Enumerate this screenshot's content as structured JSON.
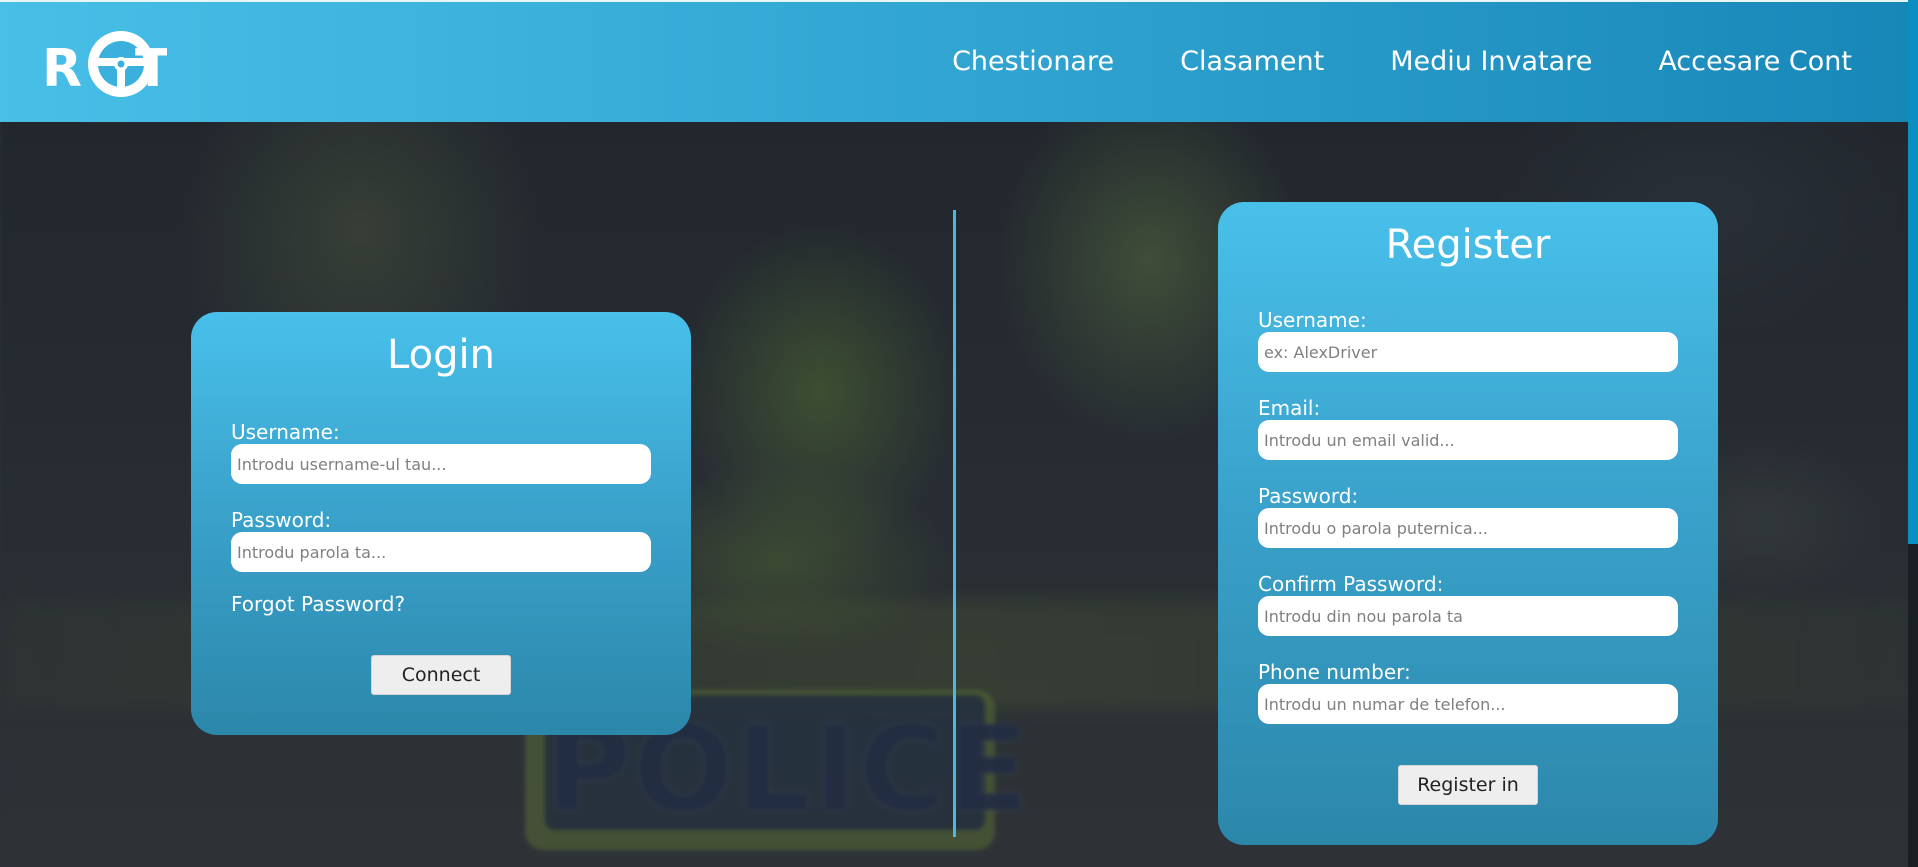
{
  "logo": {
    "text": "ROT"
  },
  "nav": {
    "items": [
      {
        "label": "Chestionare"
      },
      {
        "label": "Clasament"
      },
      {
        "label": "Mediu Invatare"
      },
      {
        "label": "Accesare Cont"
      }
    ]
  },
  "background": {
    "badge_text": "POLICE"
  },
  "login": {
    "title": "Login",
    "username_label": "Username:",
    "username_placeholder": "Introdu username-ul tau...",
    "password_label": "Password:",
    "password_placeholder": "Introdu parola ta...",
    "forgot_label": "Forgot Password?",
    "submit_label": "Connect"
  },
  "register": {
    "title": "Register",
    "username_label": "Username:",
    "username_placeholder": "ex: AlexDriver",
    "email_label": "Email:",
    "email_placeholder": "Introdu un email valid...",
    "password_label": "Password:",
    "password_placeholder": "Introdu o parola puternica...",
    "confirm_label": "Confirm Password:",
    "confirm_placeholder": "Introdu din nou parola ta",
    "phone_label": "Phone number:",
    "phone_placeholder": "Introdu un numar de telefon...",
    "submit_label": "Register in"
  },
  "colors": {
    "header_start": "#47bfe7",
    "header_end": "#1787b8",
    "card_top": "#48c0ea",
    "card_bottom": "#2c87aa",
    "divider": "#4bb8e0",
    "scrollbar_thumb": "#0b8ec0"
  }
}
